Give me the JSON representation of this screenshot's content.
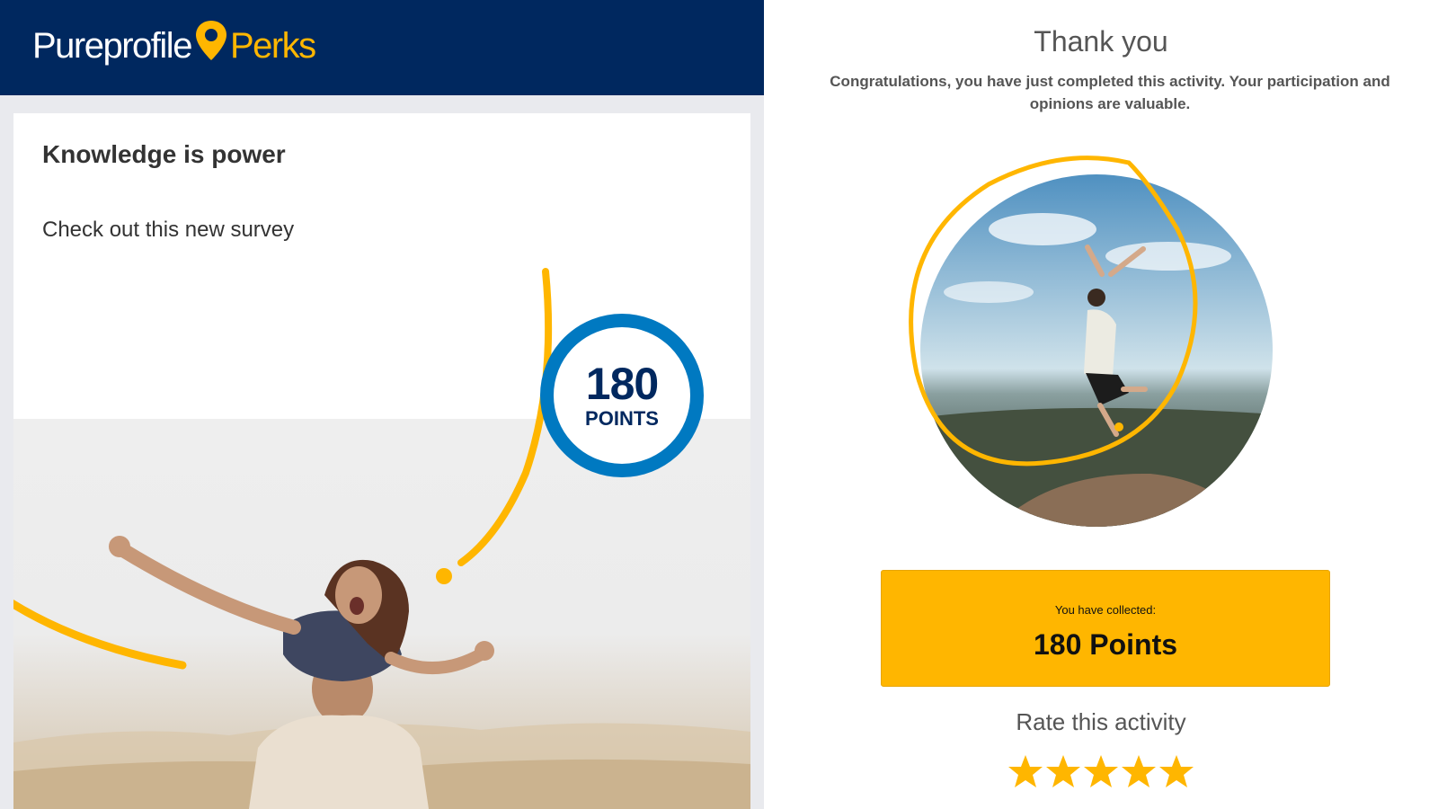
{
  "header": {
    "brand_primary": "Pureprofile",
    "brand_secondary": "Perks",
    "logo_icon": "map-pin-icon"
  },
  "card": {
    "title": "Knowledge is power",
    "subtitle": "Check out this new survey",
    "badge": {
      "value": "180",
      "unit": "POINTS"
    }
  },
  "completion": {
    "heading": "Thank you",
    "message": "Congratulations, you have just completed this activity. Your participation and opinions are valuable.",
    "collected_label": "You have collected:",
    "collected_value": "180 Points",
    "rate_label": "Rate this activity",
    "rating": 5,
    "rating_max": 5
  },
  "colors": {
    "navy": "#00285f",
    "brand_yellow": "#ffb600",
    "badge_blue": "#0079c1",
    "text_gray": "#555555"
  }
}
